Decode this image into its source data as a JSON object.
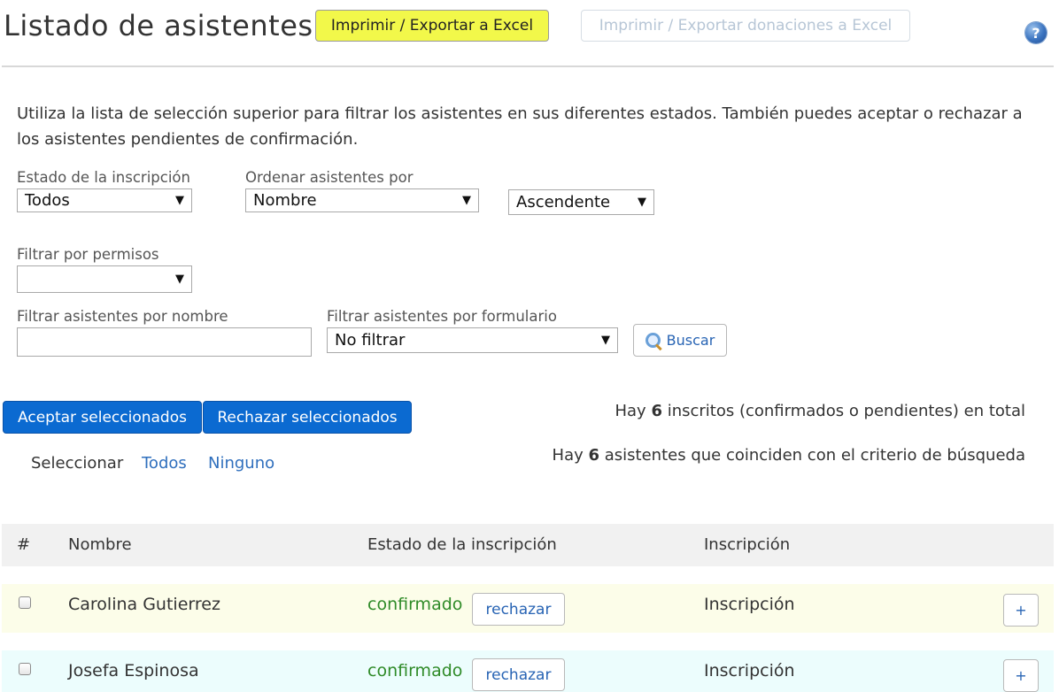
{
  "header": {
    "title": "Listado de asistentes",
    "export_label": "Imprimir / Exportar a Excel",
    "export_donations_label": "Imprimir / Exportar donaciones a Excel",
    "help_icon": "help-icon"
  },
  "intro": {
    "text": "Utiliza la lista de selección superior para filtrar los asistentes en sus diferentes estados. También puedes aceptar o rechazar a los asistentes pendientes de confirmación."
  },
  "filters": {
    "estado_label": "Estado de la inscripción",
    "estado_value": "Todos",
    "orden_label": "Ordenar asistentes por",
    "orden_value": "Nombre",
    "direccion_value": "Ascendente",
    "permisos_label": "Filtrar por permisos",
    "permisos_value": "",
    "nombre_label": "Filtrar asistentes por nombre",
    "nombre_value": "",
    "formulario_label": "Filtrar asistentes por formulario",
    "formulario_value": "No filtrar",
    "buscar_label": "Buscar"
  },
  "actions": {
    "aceptar_label": "Aceptar seleccionados",
    "rechazar_label": "Rechazar seleccionados",
    "seleccionar_label": "Seleccionar",
    "todos_label": "Todos",
    "ninguno_label": "Ninguno"
  },
  "summary": {
    "total_prefix": "Hay",
    "total_count": "6",
    "total_suffix": "inscritos (confirmados o pendientes) en total",
    "match_prefix": "Hay",
    "match_count": "6",
    "match_suffix": "asistentes que coinciden con el criterio de búsqueda"
  },
  "table": {
    "headers": [
      "#",
      "Nombre",
      "Estado de la inscripción",
      "Inscripción"
    ],
    "rows": [
      {
        "name": "Carolina Gutierrez",
        "status": "confirmado",
        "action": "rechazar",
        "inscripcion": "Inscripción",
        "expand": "+"
      },
      {
        "name": "Josefa Espinosa",
        "status": "confirmado",
        "action": "rechazar",
        "inscripcion": "Inscripción",
        "expand": "+"
      }
    ]
  },
  "colors": {
    "highlight": "#f2f84a",
    "primary_button": "#0b6ad1",
    "confirmed": "#2f8b28",
    "link": "#2f6fbd",
    "row1_bg": "#fcfde9",
    "row2_bg": "#ecfdfd"
  }
}
